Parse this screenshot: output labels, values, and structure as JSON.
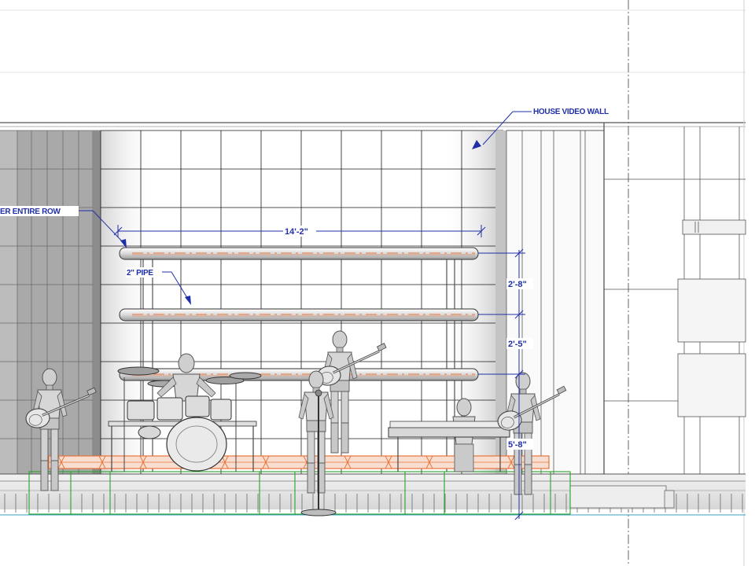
{
  "annotations": {
    "house_video_wall": "HOUSE VIDEO WALL",
    "entire_row": "ER ENTIRE ROW",
    "pipe": "2\" PIPE"
  },
  "dimensions": {
    "width": "14'-2\"",
    "spacing_upper": "2'-8\"",
    "spacing_middle": "2'-5\"",
    "height_lower": "5'-8\""
  },
  "colors": {
    "annotation": "#1f2fa8",
    "truss": "#e8743a",
    "riser_outline": "#27a327",
    "ground_line": "#3aa0c0",
    "linework": "#4a4a4a"
  },
  "icons": [
    "performer-figure",
    "drum-kit",
    "guitar",
    "keyboard"
  ]
}
